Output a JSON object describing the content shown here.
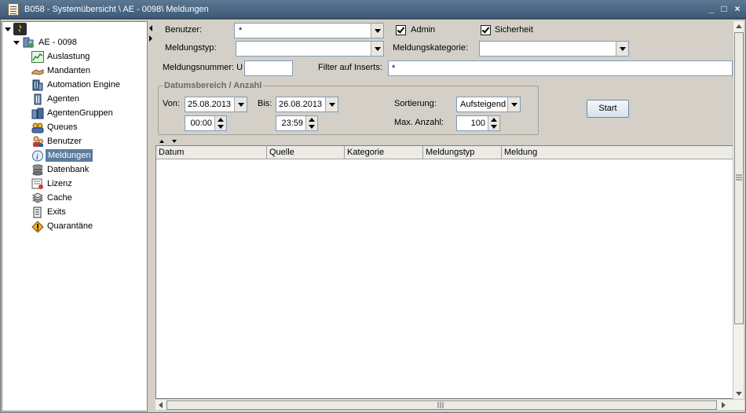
{
  "window": {
    "title": "B058 - Systemübersicht \\ AE - 0098\\ Meldungen",
    "controls": [
      "_",
      "□",
      "×"
    ]
  },
  "tree": {
    "root_label": "AE - 0098",
    "items": [
      {
        "label": "Auslastung",
        "icon": "chart-icon"
      },
      {
        "label": "Mandanten",
        "icon": "handshake-icon"
      },
      {
        "label": "Automation Engine",
        "icon": "building-icon"
      },
      {
        "label": "Agenten",
        "icon": "agent-building-icon"
      },
      {
        "label": "AgentenGruppen",
        "icon": "agent-group-icon"
      },
      {
        "label": "Queues",
        "icon": "queues-icon"
      },
      {
        "label": "Benutzer",
        "icon": "users-icon"
      },
      {
        "label": "Meldungen",
        "icon": "info-icon",
        "selected": true
      },
      {
        "label": "Datenbank",
        "icon": "database-icon"
      },
      {
        "label": "Lizenz",
        "icon": "license-icon"
      },
      {
        "label": "Cache",
        "icon": "cache-icon"
      },
      {
        "label": "Exits",
        "icon": "exits-icon"
      },
      {
        "label": "Quarantäne",
        "icon": "warning-icon"
      }
    ]
  },
  "filters": {
    "benutzer_label": "Benutzer:",
    "benutzer_value": "*",
    "admin_label": "Admin",
    "admin_checked": true,
    "sicherheit_label": "Sicherheit",
    "sicherheit_checked": true,
    "meldungstyp_label": "Meldungstyp:",
    "meldungstyp_value": "",
    "meldungskategorie_label": "Meldungskategorie:",
    "meldungskategorie_value": "",
    "meldungsnummer_label": "Meldungsnummer: U",
    "meldungsnummer_value": "",
    "filter_inserts_label": "Filter auf Inserts:",
    "filter_inserts_value": "*"
  },
  "date_range": {
    "group_title": "Datumsbereich / Anzahl",
    "von_label": "Von:",
    "von_date": "25.08.2013",
    "von_time": "00:00",
    "bis_label": "Bis:",
    "bis_date": "26.08.2013",
    "bis_time": "23:59",
    "sortierung_label": "Sortierung:",
    "sortierung_value": "Aufsteigend",
    "max_anzahl_label": "Max. Anzahl:",
    "max_anzahl_value": "100"
  },
  "start_button": "Start",
  "table": {
    "columns": [
      "Datum",
      "Quelle",
      "Kategorie",
      "Meldungstyp",
      "Meldung"
    ],
    "rows": []
  },
  "colors": {
    "titlebar": "#4a6884",
    "selection": "#5b7c9e",
    "background": "#d4d0c8"
  }
}
